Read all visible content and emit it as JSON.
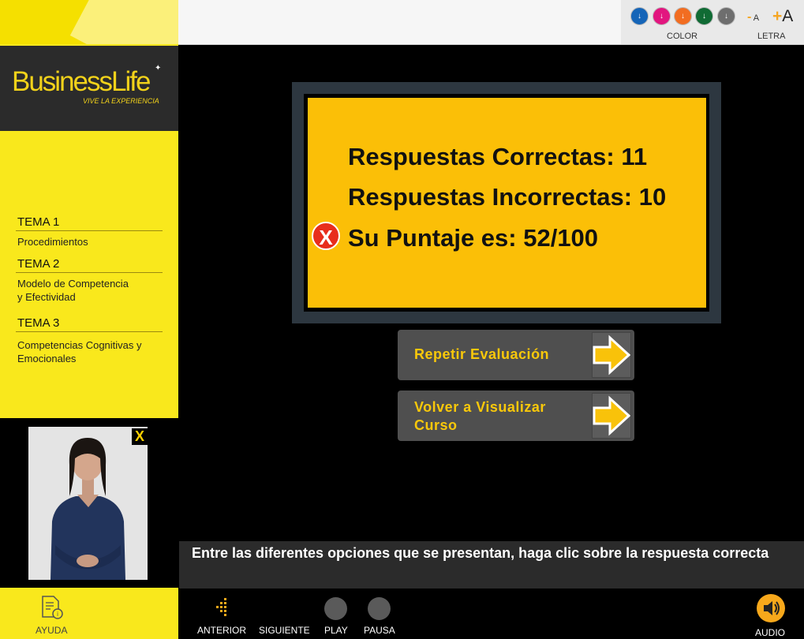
{
  "brand": {
    "name": "BusinessLife",
    "tagline": "VIVE LA EXPERIENCIA"
  },
  "sidebar": {
    "topics": [
      {
        "title": "TEMA 1",
        "subtitle": "Procedimientos"
      },
      {
        "title": "TEMA 2",
        "subtitle_line1": "Modelo de Competencia",
        "subtitle_line2": "y Efectividad"
      },
      {
        "title": "TEMA 3",
        "subtitle_line1": "Competencias Cognitivas y",
        "subtitle_line2": "Emocionales"
      }
    ],
    "video_close": "X",
    "help_label": "AYUDA"
  },
  "toolbar": {
    "colors": [
      "#1565b8",
      "#e2167f",
      "#f26d21",
      "#106b34",
      "#6e6e6e"
    ],
    "color_label": "COLOR",
    "font_decrease": "-A",
    "font_increase": "+A",
    "font_label": "LETRA"
  },
  "result": {
    "correct": "Respuestas Correctas: 11",
    "incorrect": "Respuestas Incorrectas: 10",
    "score": "Su Puntaje es: 52/100",
    "fail_icon": "X"
  },
  "actions": {
    "retry": "Repetir Evaluación",
    "review_line1": "Volver a Visualizar",
    "review_line2": "Curso"
  },
  "instruction": "Entre las diferentes opciones que se presentan, haga clic sobre la respuesta correcta",
  "nav": {
    "previous": "ANTERIOR",
    "next": "SIGUIENTE",
    "play": "PLAY",
    "pause": "PAUSA",
    "audio": "AUDIO"
  }
}
